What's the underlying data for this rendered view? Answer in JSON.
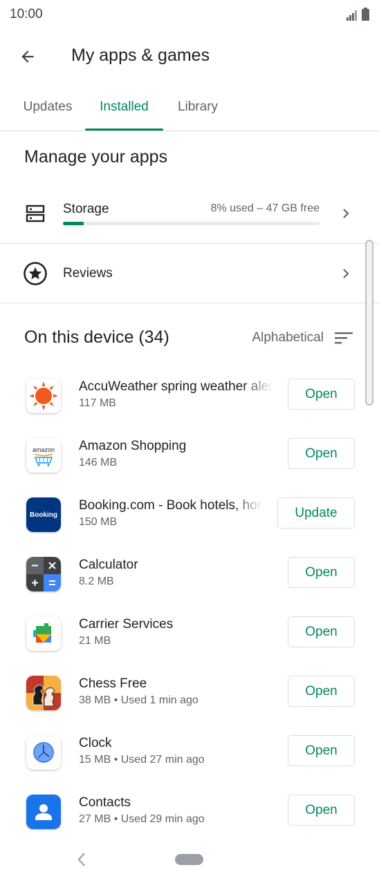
{
  "status": {
    "time": "10:00"
  },
  "header": {
    "title": "My apps & games"
  },
  "tabs": [
    {
      "label": "Updates",
      "active": false
    },
    {
      "label": "Installed",
      "active": true
    },
    {
      "label": "Library",
      "active": false
    }
  ],
  "manage": {
    "title": "Manage your apps",
    "storage": {
      "label": "Storage",
      "meta": "8% used – 47 GB free",
      "used_fraction": 0.08
    },
    "reviews": {
      "label": "Reviews"
    }
  },
  "device": {
    "title": "On this device (34)",
    "sort_label": "Alphabetical"
  },
  "apps": [
    {
      "name": "AccuWeather spring weather alerts",
      "sub": "117 MB",
      "action": "Open",
      "icon": "accuweather-icon"
    },
    {
      "name": "Amazon Shopping",
      "sub": "146 MB",
      "action": "Open",
      "icon": "amazon-icon"
    },
    {
      "name": "Booking.com - Book hotels, homes",
      "sub": "150 MB",
      "action": "Update",
      "icon": "booking-icon"
    },
    {
      "name": "Calculator",
      "sub": "8.2 MB",
      "action": "Open",
      "icon": "calculator-icon"
    },
    {
      "name": "Carrier Services",
      "sub": "21 MB",
      "action": "Open",
      "icon": "carrier-services-icon"
    },
    {
      "name": "Chess Free",
      "sub": "38 MB • Used 1 min ago",
      "action": "Open",
      "icon": "chess-icon"
    },
    {
      "name": "Clock",
      "sub": "15 MB • Used 27 min ago",
      "action": "Open",
      "icon": "clock-icon"
    },
    {
      "name": "Contacts",
      "sub": "27 MB • Used 29 min ago",
      "action": "Open",
      "icon": "contacts-icon"
    }
  ],
  "icon_text": {
    "amazon": "amazon",
    "booking": "Booking"
  },
  "colors": {
    "accent": "#01875f",
    "text_primary": "#202124",
    "text_secondary": "#5f6368",
    "divider": "#dadce0"
  }
}
